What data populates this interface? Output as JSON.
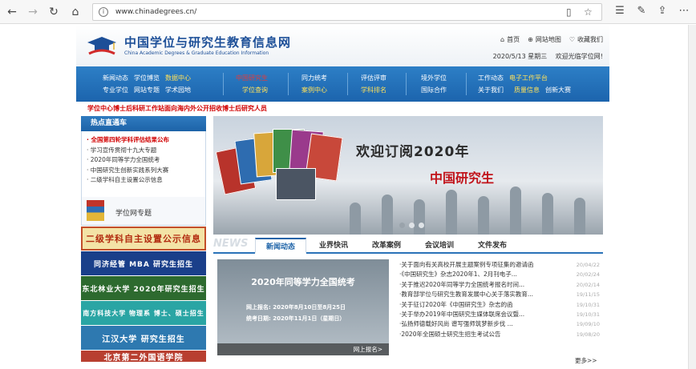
{
  "browser": {
    "url": "www.chinadegrees.cn/"
  },
  "header": {
    "title_cn": "中国学位与研究生教育信息网",
    "title_en": "China Academic Degrees & Graduate Education Information",
    "links": [
      "首页",
      "网站地图",
      "收藏我们"
    ],
    "date": "2020/5/13 星期三",
    "welcome": "欢迎光临学位网!"
  },
  "nav": {
    "g1": [
      "新闻动态",
      "学位博览",
      "数据中心",
      "专业学位",
      "网站专题",
      "学术园地"
    ],
    "g2": [
      "中国研究生",
      "学位查询"
    ],
    "g3": [
      "同力统考",
      "案例中心"
    ],
    "g4": [
      "评估评审",
      "学科排名"
    ],
    "g5": [
      "境外学位",
      "国际合作"
    ],
    "g6": [
      "工作动态",
      "电子工作平台",
      "关于我们",
      "质量信息",
      "创新大赛"
    ]
  },
  "ticker": "学位中心博士后科研工作站面向海内外公开招收博士后研究人员",
  "sidebar": {
    "hot_title": "热点直通车",
    "hot_items": [
      "全国第四轮学科评估结果公布",
      "学习宣传贯彻十九大专题",
      "2020年同等学力全国统考",
      "中国研究生创新实践系列大赛",
      "二级学科自主设置公示信息"
    ],
    "topic_title": "学位网专题",
    "banners": [
      "二级学科自主设置公示信息",
      "同济经管 MBA 研究生招生",
      "东北林业大学 2020年研究生招生",
      "南方科技大学 物理系 博士、硕士招生",
      "江汉大学 研究生招生",
      "北京第二外国语学院"
    ]
  },
  "slide": {
    "title": "欢迎订阅2020年",
    "logo": "中国研究生"
  },
  "news": {
    "brand": "NEWS",
    "tabs": [
      "新闻动态",
      "业界快讯",
      "改革案例",
      "会议培训",
      "文件发布"
    ],
    "feature": {
      "title": "2020年同等学力全国统考",
      "line1": "网上报名: 2020年8月10日至8月25日",
      "line2": "统考日期: 2020年11月1日（星期日）",
      "caption": "网上报名>"
    },
    "items": [
      {
        "text": "·关于面向有关高校开展主题案例专项征集的邀请函",
        "date": "20/04/22"
      },
      {
        "text": "·《中国研究生》杂志2020年1、2月刊电子...",
        "date": "20/02/24"
      },
      {
        "text": "·关于推迟2020年同等学力全国统考报名时间...",
        "date": "20/02/14"
      },
      {
        "text": "·教育部学位与研究生教育发展中心关于落实教育...",
        "date": "19/11/15"
      },
      {
        "text": "·关于征订2020年《中国研究生》杂志的函",
        "date": "19/10/31"
      },
      {
        "text": "·关于举办2019年中国研究生媒体联席会议暨...",
        "date": "19/10/31"
      },
      {
        "text": "·弘扬师德载好风尚 谱写强师筑梦新步伐 ...",
        "date": "19/09/10"
      },
      {
        "text": "·2020年全国硕士研究生招生考试公告",
        "date": "19/08/20"
      }
    ],
    "more": "更多>>"
  }
}
